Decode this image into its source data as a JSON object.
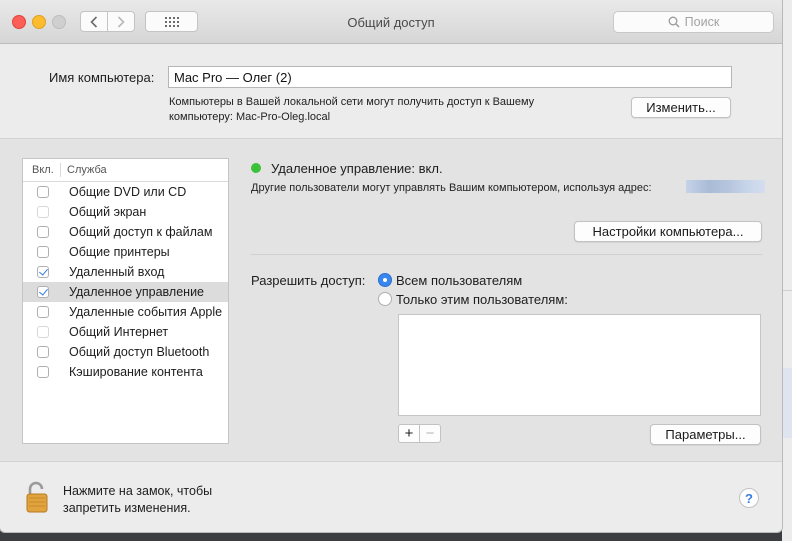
{
  "window": {
    "title": "Общий доступ",
    "search_placeholder": "Поиск"
  },
  "computer_name": {
    "label": "Имя компьютера:",
    "value": "Mac Pro — Олег (2)",
    "info_line1": "Компьютеры в Вашей локальной сети могут получить доступ к Вашему",
    "info_line2": "компьютеру: Mac-Pro-Oleg.local",
    "change_button": "Изменить..."
  },
  "services": {
    "header_on": "Вкл.",
    "header_service": "Служба",
    "items": [
      {
        "label": "Общие DVD или CD",
        "checked": false,
        "disabled": false
      },
      {
        "label": "Общий экран",
        "checked": false,
        "disabled": true
      },
      {
        "label": "Общий доступ к файлам",
        "checked": false,
        "disabled": false
      },
      {
        "label": "Общие принтеры",
        "checked": false,
        "disabled": false
      },
      {
        "label": "Удаленный вход",
        "checked": true,
        "disabled": false
      },
      {
        "label": "Удаленное управление",
        "checked": true,
        "disabled": false,
        "selected": true
      },
      {
        "label": "Удаленные события Apple",
        "checked": false,
        "disabled": false
      },
      {
        "label": "Общий Интернет",
        "checked": false,
        "disabled": true
      },
      {
        "label": "Общий доступ Bluetooth",
        "checked": false,
        "disabled": false
      },
      {
        "label": "Кэширование контента",
        "checked": false,
        "disabled": false
      }
    ]
  },
  "detail": {
    "status_color": "#3cc13b",
    "status": "Удаленное управление: вкл.",
    "description": "Другие пользователи могут управлять Вашим компьютером, используя адрес:",
    "settings_button": "Настройки компьютера...",
    "allow_label": "Разрешить доступ:",
    "option_all": "Всем пользователям",
    "option_only": "Только этим пользователям:",
    "selected_option": "all",
    "add_button": "+",
    "remove_button": "−",
    "params_button": "Параметры..."
  },
  "footer": {
    "lock_line1": "Нажмите на замок, чтобы",
    "lock_line2": "запретить изменения.",
    "help_button": "?"
  }
}
